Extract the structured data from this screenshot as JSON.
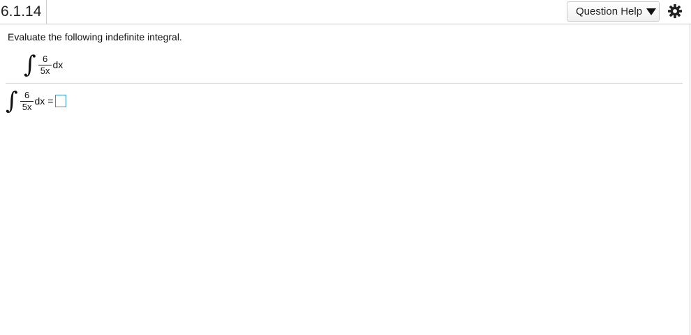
{
  "header": {
    "question_number": "6.1.14",
    "help_label": "Question Help",
    "help_icon": "caret-down-icon",
    "settings_icon": "gear-icon"
  },
  "question": {
    "prompt": "Evaluate the following indefinite integral.",
    "integrand_numerator": "6",
    "integrand_denominator": "5x",
    "differential": "dx"
  },
  "answer": {
    "equals": "=",
    "value": ""
  },
  "colors": {
    "answer_box_border": "#3b8fc3",
    "divider": "#cfcfcf"
  }
}
